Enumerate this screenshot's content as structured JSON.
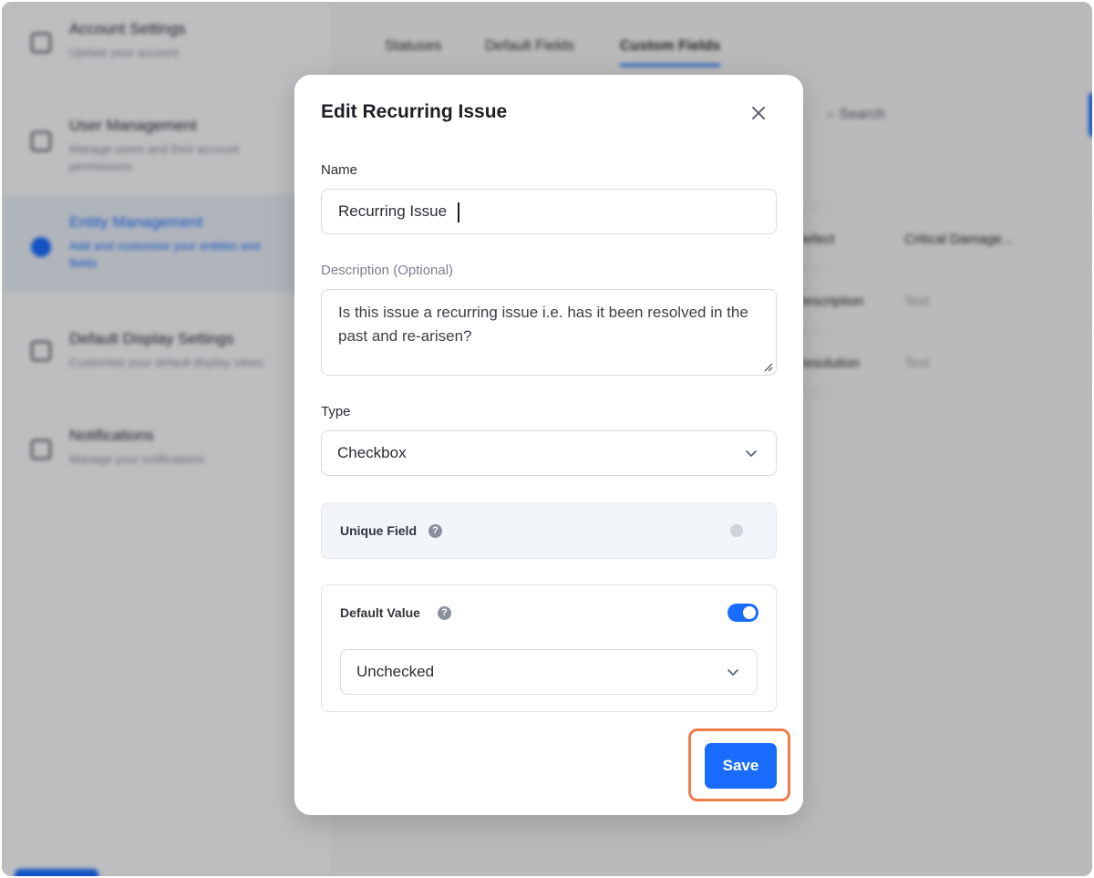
{
  "background": {
    "sidebar": {
      "items": [
        {
          "title": "Account Settings",
          "subtitle": "Update your account"
        },
        {
          "title": "User Management",
          "subtitle": "Manage users and their account permissions"
        },
        {
          "title": "Entity Management",
          "subtitle": "Add and customise your entities and fields"
        },
        {
          "title": "Default Display Settings",
          "subtitle": "Customise your default display views"
        },
        {
          "title": "Notifications",
          "subtitle": "Manage your notifications"
        }
      ]
    },
    "tabs": [
      "Statuses",
      "Default Fields",
      "Custom Fields"
    ],
    "search_placeholder": "Search",
    "table": {
      "rows": [
        {
          "name": "Defect",
          "type": "Critical Damage..."
        },
        {
          "name": "Description",
          "type": "Text"
        },
        {
          "name": "Resolution",
          "type": "Text"
        }
      ]
    }
  },
  "modal": {
    "title": "Edit Recurring Issue",
    "name_label": "Name",
    "name_value": "Recurring Issue",
    "description_label": "Description (Optional)",
    "description_value": "Is this issue a recurring issue i.e. has it been resolved in the past and re-arisen?",
    "type_label": "Type",
    "type_value": "Checkbox",
    "unique_label": "Unique Field",
    "unique_enabled": false,
    "default_label": "Default Value",
    "default_enabled": true,
    "default_value": "Unchecked",
    "save_label": "Save"
  },
  "colors": {
    "accent": "#1a6cff",
    "highlight": "#f07c4a"
  },
  "icons": {
    "close": "close-icon",
    "help": "question-circle-icon",
    "chevron": "chevron-down-icon"
  }
}
